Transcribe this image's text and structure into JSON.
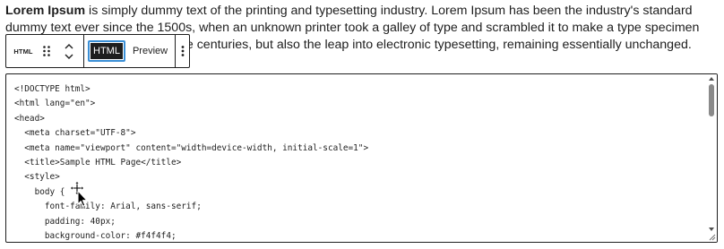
{
  "paragraph": {
    "bold": "Lorem Ipsum",
    "text": " is simply dummy text of the printing and typesetting industry. Lorem Ipsum has been the industry's standard dummy text ever since the 1500s, when an unknown printer took a galley of type and scrambled it to make a type specimen book. It has survived not only five centuries, but also the leap into electronic typesetting, remaining essentially unchanged."
  },
  "toolbar": {
    "block_type": "HTML",
    "drag_icon": "drag-handle-icon",
    "move_up_icon": "chevron-up-icon",
    "move_down_icon": "chevron-down-icon",
    "tab_html": "HTML",
    "tab_preview": "Preview",
    "active_tab": "HTML",
    "more_icon": "more-vertical-icon"
  },
  "code_editor": {
    "lines": [
      "<!DOCTYPE html>",
      "<html lang=\"en\">",
      "<head>",
      "  <meta charset=\"UTF-8\">",
      "  <meta name=\"viewport\" content=\"width=device-width, initial-scale=1\">",
      "  <title>Sample HTML Page</title>",
      "  <style>",
      "    body {",
      "      font-family: Arial, sans-serif;",
      "      padding: 40px;",
      "      background-color: #f4f4f4;"
    ]
  },
  "colors": {
    "text": "#1e1e1e",
    "accent": "#3a8fd6",
    "active_tab_bg": "#1e1e1e"
  }
}
